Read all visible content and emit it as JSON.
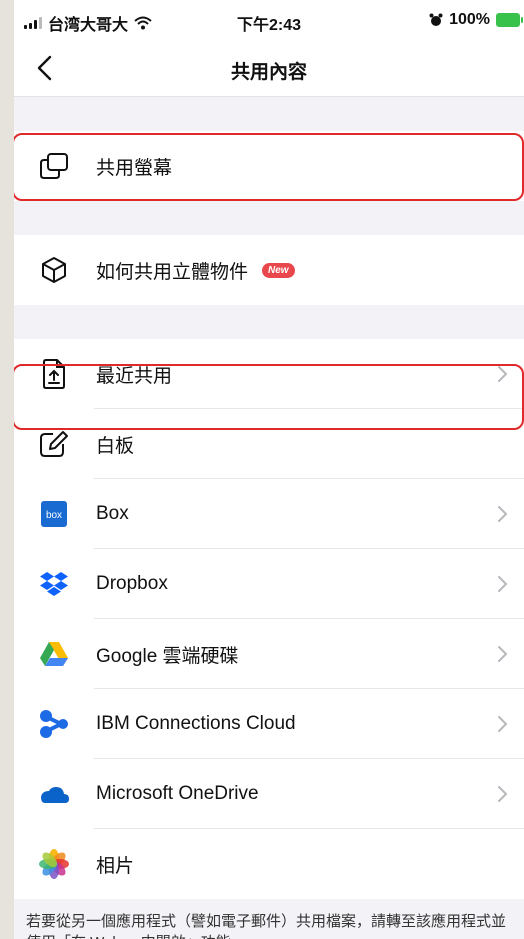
{
  "status": {
    "carrier": "台湾大哥大",
    "time": "下午2:43",
    "battery": "100%"
  },
  "nav": {
    "title": "共用內容"
  },
  "section1": [
    {
      "label": "共用螢幕",
      "icon": "screen-share-icon"
    }
  ],
  "section2": [
    {
      "label": "如何共用立體物件",
      "icon": "cube-icon",
      "badge": "New"
    }
  ],
  "section3": [
    {
      "label": "最近共用",
      "icon": "recent-upload-icon"
    },
    {
      "label": "白板",
      "icon": "whiteboard-edit-icon"
    },
    {
      "label": "Box",
      "icon": "box-logo-icon"
    },
    {
      "label": "Dropbox",
      "icon": "dropbox-logo-icon"
    },
    {
      "label": "Google 雲端硬碟",
      "icon": "google-drive-icon"
    },
    {
      "label": "IBM Connections Cloud",
      "icon": "ibm-connections-icon"
    },
    {
      "label": "Microsoft OneDrive",
      "icon": "onedrive-icon"
    },
    {
      "label": "相片",
      "icon": "photos-icon"
    }
  ],
  "footer": {
    "text": "若要從另一個應用程式（譬如電子郵件）共用檔案，請轉至該應用程式並使用「在 Webex 中開啟」功能。"
  },
  "colors": {
    "highlight": "#e02a2a",
    "badge": "#e8474b",
    "battery": "#38c24b"
  }
}
